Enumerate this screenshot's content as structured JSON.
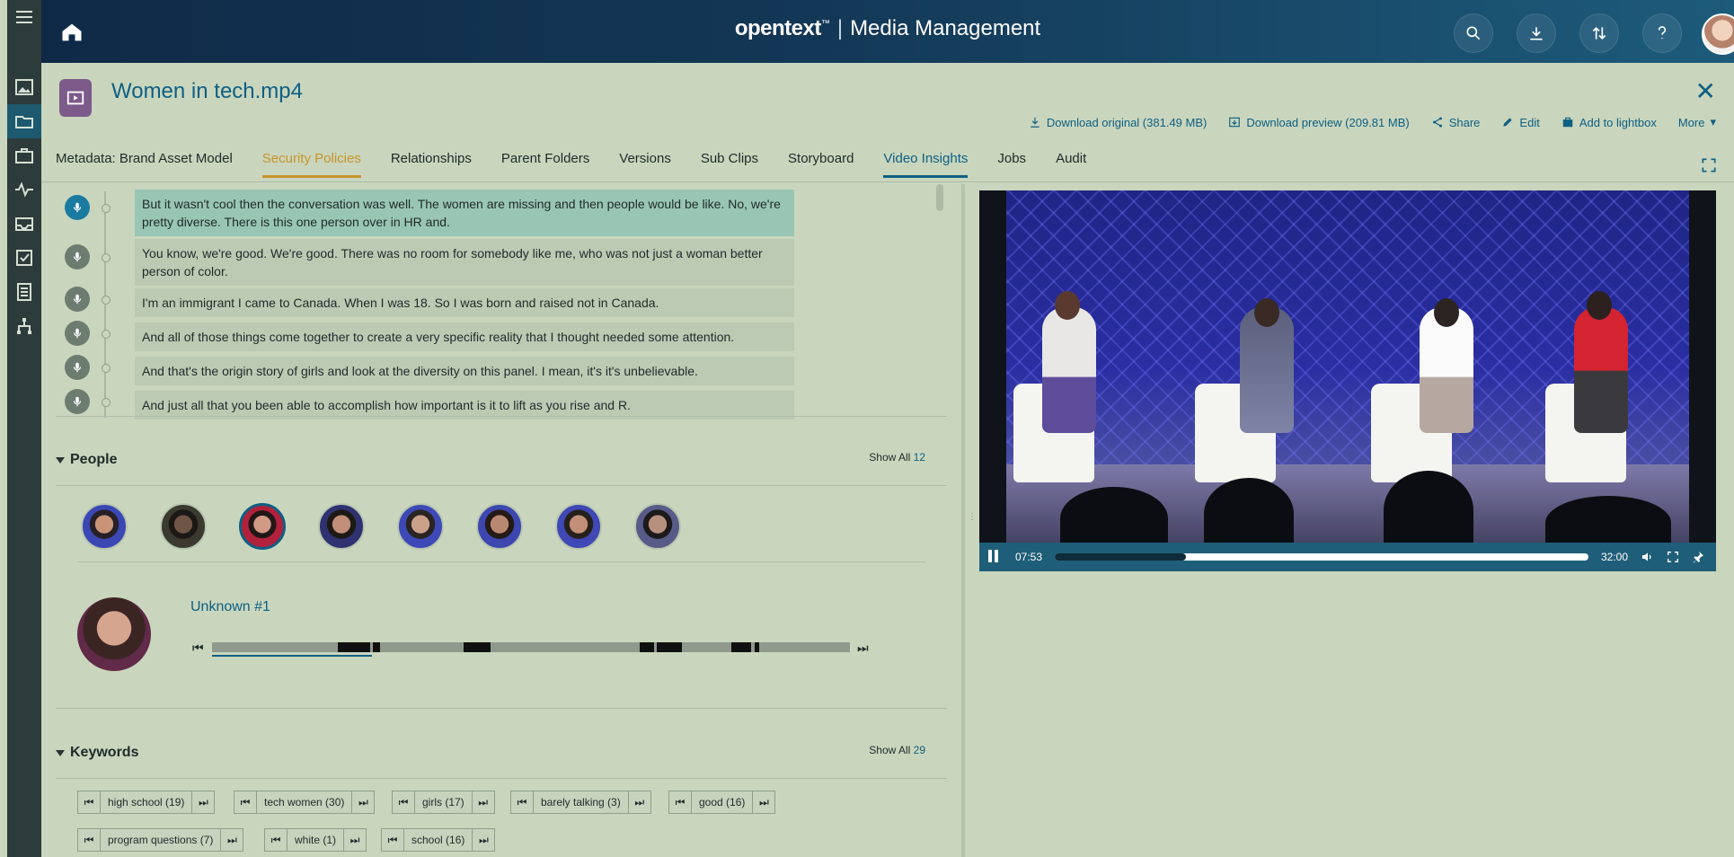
{
  "header": {
    "brand_main": "opentext",
    "brand_tm": "™",
    "brand_separator": "|",
    "brand_sub": "Media Management"
  },
  "asset": {
    "title": "Women in tech.mp4",
    "actions": [
      {
        "label": "Download original (381.49 MB)",
        "icon": "download-icon"
      },
      {
        "label": "Download preview (209.81 MB)",
        "icon": "download-preview-icon"
      },
      {
        "label": "Share",
        "icon": "share-icon"
      },
      {
        "label": "Edit",
        "icon": "pencil-icon"
      },
      {
        "label": "Add to lightbox",
        "icon": "lightbox-icon"
      },
      {
        "label": "More",
        "icon": "chevron-down-icon"
      }
    ]
  },
  "tabs": [
    {
      "label": "Metadata: Brand Asset Model"
    },
    {
      "label": "Security Policies"
    },
    {
      "label": "Relationships"
    },
    {
      "label": "Parent Folders"
    },
    {
      "label": "Versions"
    },
    {
      "label": "Sub Clips"
    },
    {
      "label": "Storyboard"
    },
    {
      "label": "Video Insights"
    },
    {
      "label": "Jobs"
    },
    {
      "label": "Audit"
    }
  ],
  "transcript": [
    {
      "text": "But it wasn't cool then the conversation was well. The women are missing and then people would be like. No, we're pretty diverse. There is this one person over in HR and."
    },
    {
      "text": "You know, we're good. We're good. There was no room for somebody like me, who was not just a woman better person of color."
    },
    {
      "text": "I'm an immigrant I came to Canada. When I was 18. So I was born and raised not in Canada."
    },
    {
      "text": "And all of those things come together to create a very specific reality that I thought needed some attention."
    },
    {
      "text": "And that's the origin story of girls and look at the diversity on this panel. I mean, it's it's unbelievable."
    },
    {
      "text": "And just all that you been able to accomplish how important is it to lift as you rise and R."
    }
  ],
  "people": {
    "title": "People",
    "show_all_label": "Show All",
    "show_all_count": "12",
    "selected_name": "Unknown #1",
    "timeline_progress": 0.25
  },
  "keywords": {
    "title": "Keywords",
    "show_all_label": "Show All",
    "show_all_count": "29",
    "items": [
      {
        "label": "high school (19)"
      },
      {
        "label": "tech women (30)"
      },
      {
        "label": "girls (17)"
      },
      {
        "label": "barely talking (3)"
      },
      {
        "label": "good (16)"
      },
      {
        "label": "program questions (7)"
      },
      {
        "label": "white (1)"
      },
      {
        "label": "school (16)"
      }
    ]
  },
  "video": {
    "current_time": "07:53",
    "duration": "32:00",
    "progress": 0.246
  },
  "colors": {
    "accent": "#0e5f84",
    "tab_security": "#c8942a",
    "panel_bg": "#c9d6bd",
    "header_dark": "#0f2a47"
  }
}
